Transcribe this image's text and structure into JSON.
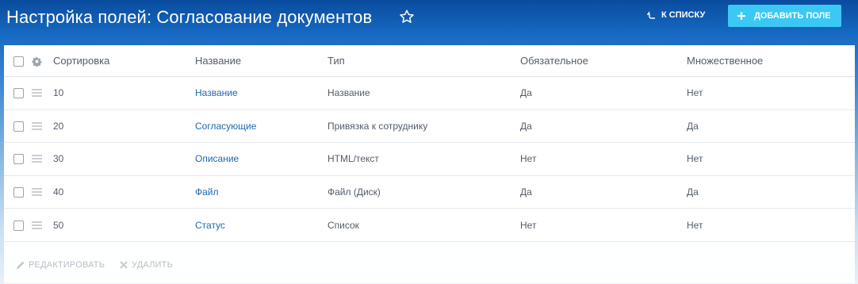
{
  "header": {
    "title": "Настройка полей: Согласование документов",
    "back_label": "К СПИСКУ",
    "add_label": "ДОБАВИТЬ ПОЛЕ"
  },
  "table": {
    "columns": {
      "sort": "Сортировка",
      "name": "Название",
      "type": "Тип",
      "required": "Обязательное",
      "multiple": "Множественное"
    },
    "rows": [
      {
        "sort": "10",
        "name": "Название",
        "type": "Название",
        "required": "Да",
        "multiple": "Нет"
      },
      {
        "sort": "20",
        "name": "Согласующие",
        "type": "Привязка к сотруднику",
        "required": "Да",
        "multiple": "Да"
      },
      {
        "sort": "30",
        "name": "Описание",
        "type": "HTML/текст",
        "required": "Нет",
        "multiple": "Нет"
      },
      {
        "sort": "40",
        "name": "Файл",
        "type": "Файл (Диск)",
        "required": "Да",
        "multiple": "Да"
      },
      {
        "sort": "50",
        "name": "Статус",
        "type": "Список",
        "required": "Нет",
        "multiple": "Нет"
      }
    ]
  },
  "footer": {
    "edit_label": "РЕДАКТИРОВАТЬ",
    "delete_label": "УДАЛИТЬ"
  },
  "colors": {
    "accent_button": "#3bc8f5",
    "link": "#2067b0",
    "text": "#535c69",
    "disabled": "#b9bfc5"
  },
  "icons": [
    "star-icon",
    "back-arrow-icon",
    "plus-icon",
    "gear-icon",
    "drag-handle-icon",
    "pencil-icon",
    "close-icon"
  ]
}
